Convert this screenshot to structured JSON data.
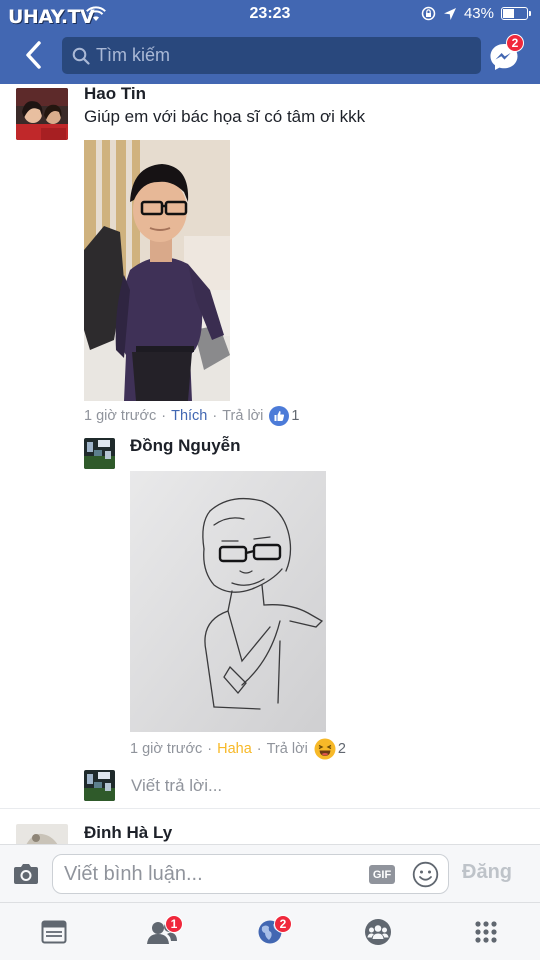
{
  "status_bar": {
    "watermark": "UHAY.TV",
    "time": "23:23",
    "battery": "43%",
    "battery_level": 0.43
  },
  "nav": {
    "search_placeholder": "Tìm kiếm",
    "messenger_badge": "2"
  },
  "comments": [
    {
      "author": "Hao Tin",
      "text": "Giúp em với bác họa sĩ có tâm ơi kkk",
      "time": "1 giờ trước",
      "action": "Thích",
      "reply_label": "Trả lời",
      "reaction": "like",
      "reaction_count": "1"
    }
  ],
  "reply": {
    "author": "Đồng Nguyễn",
    "time": "1 giờ trước",
    "action": "Haha",
    "reply_label": "Trả lời",
    "reaction": "haha",
    "reaction_count": "2"
  },
  "write_reply_placeholder": "Viết trả lời...",
  "next_comment_author": "Đinh Hà Ly",
  "composer": {
    "placeholder": "Viết bình luận...",
    "gif_label": "GIF",
    "post_label": "Đăng"
  },
  "tabbar": {
    "friend_requests_badge": "1",
    "notifications_badge": "2"
  },
  "colors": {
    "brand": "#4267b2",
    "search_bg": "#29487d",
    "badge": "#f0283c",
    "haha": "#f7b928"
  }
}
